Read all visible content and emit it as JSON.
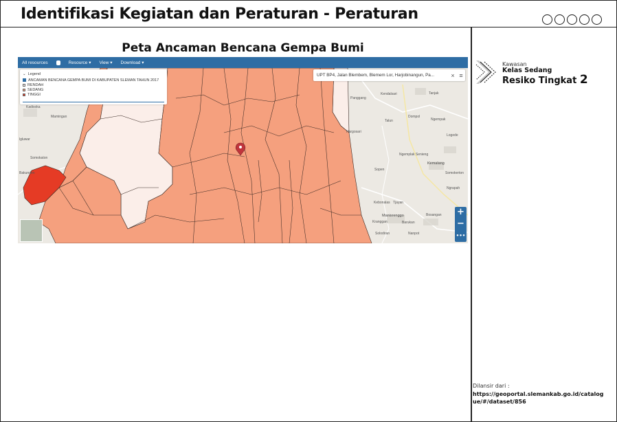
{
  "header": {
    "title": "Identifikasi Kegiatan dan Peraturan - Peraturan",
    "progress_circles": 5
  },
  "map_section": {
    "title": "Peta Ancaman Bencana Gempa Bumi",
    "toolbar": {
      "all_resources": "All resources",
      "resource": "Resource ▾",
      "view": "View ▾",
      "download": "Download ▾"
    },
    "legend": {
      "header": "Legend",
      "layer": "ANCAMAN BENCANA GEMPA BUMI DI KABUPATEN SLEMAN TAHUN 2017",
      "classes": [
        {
          "label": "RENDAH",
          "color": "#f7f0ee"
        },
        {
          "label": "SEDANG",
          "color": "#f5a07e"
        },
        {
          "label": "TINGGI",
          "color": "#e53b25"
        }
      ]
    },
    "search": {
      "value": "UPT BP4, Jalan Blembem, Blemem Lor, Harjobinangun, Pa...",
      "close_icon": "close-icon",
      "menu_icon": "menu-icon"
    },
    "zoom": {
      "in": "+",
      "out": "−",
      "more": "•••"
    },
    "place_labels": [
      "Kadisoka",
      "Mamingan",
      "Rumbu Wetan",
      "Gancaran",
      "lgluwar",
      "Somokaton",
      "Bakunden",
      "Pakem",
      "Kendalsari",
      "Panggang",
      "Tanjak",
      "Talun",
      "Dompol",
      "Ngempak",
      "Ngemplak Senieng",
      "Kemalang",
      "Logede",
      "Sopen",
      "Hargosari",
      "Somokerton",
      "Kebonalas",
      "Tjayan",
      "Manisrenggo",
      "Kranggan",
      "Barukan",
      "Bosangan",
      "Solodiran",
      "Nanpot",
      "Jabal",
      "Kenalayo",
      "Bendan",
      "Ngrapah",
      "Tarrik",
      "Kaliwakan",
      "Kendalsari"
    ],
    "colors": {
      "high": "#e53b25",
      "medium": "#f5a07e",
      "low": "#fbeee9",
      "toolbar": "#2e6da4",
      "marker": "#c0353c"
    }
  },
  "side_panel": {
    "label_small": "Kawasan",
    "label_mid": "Kelas Sedang",
    "label_big": "Resiko Tingkat",
    "level": "2",
    "source_label": "Dilansir dari :",
    "source_url": "https://geoportal.slemankab.go.id/catalogue/#/dataset/856"
  }
}
